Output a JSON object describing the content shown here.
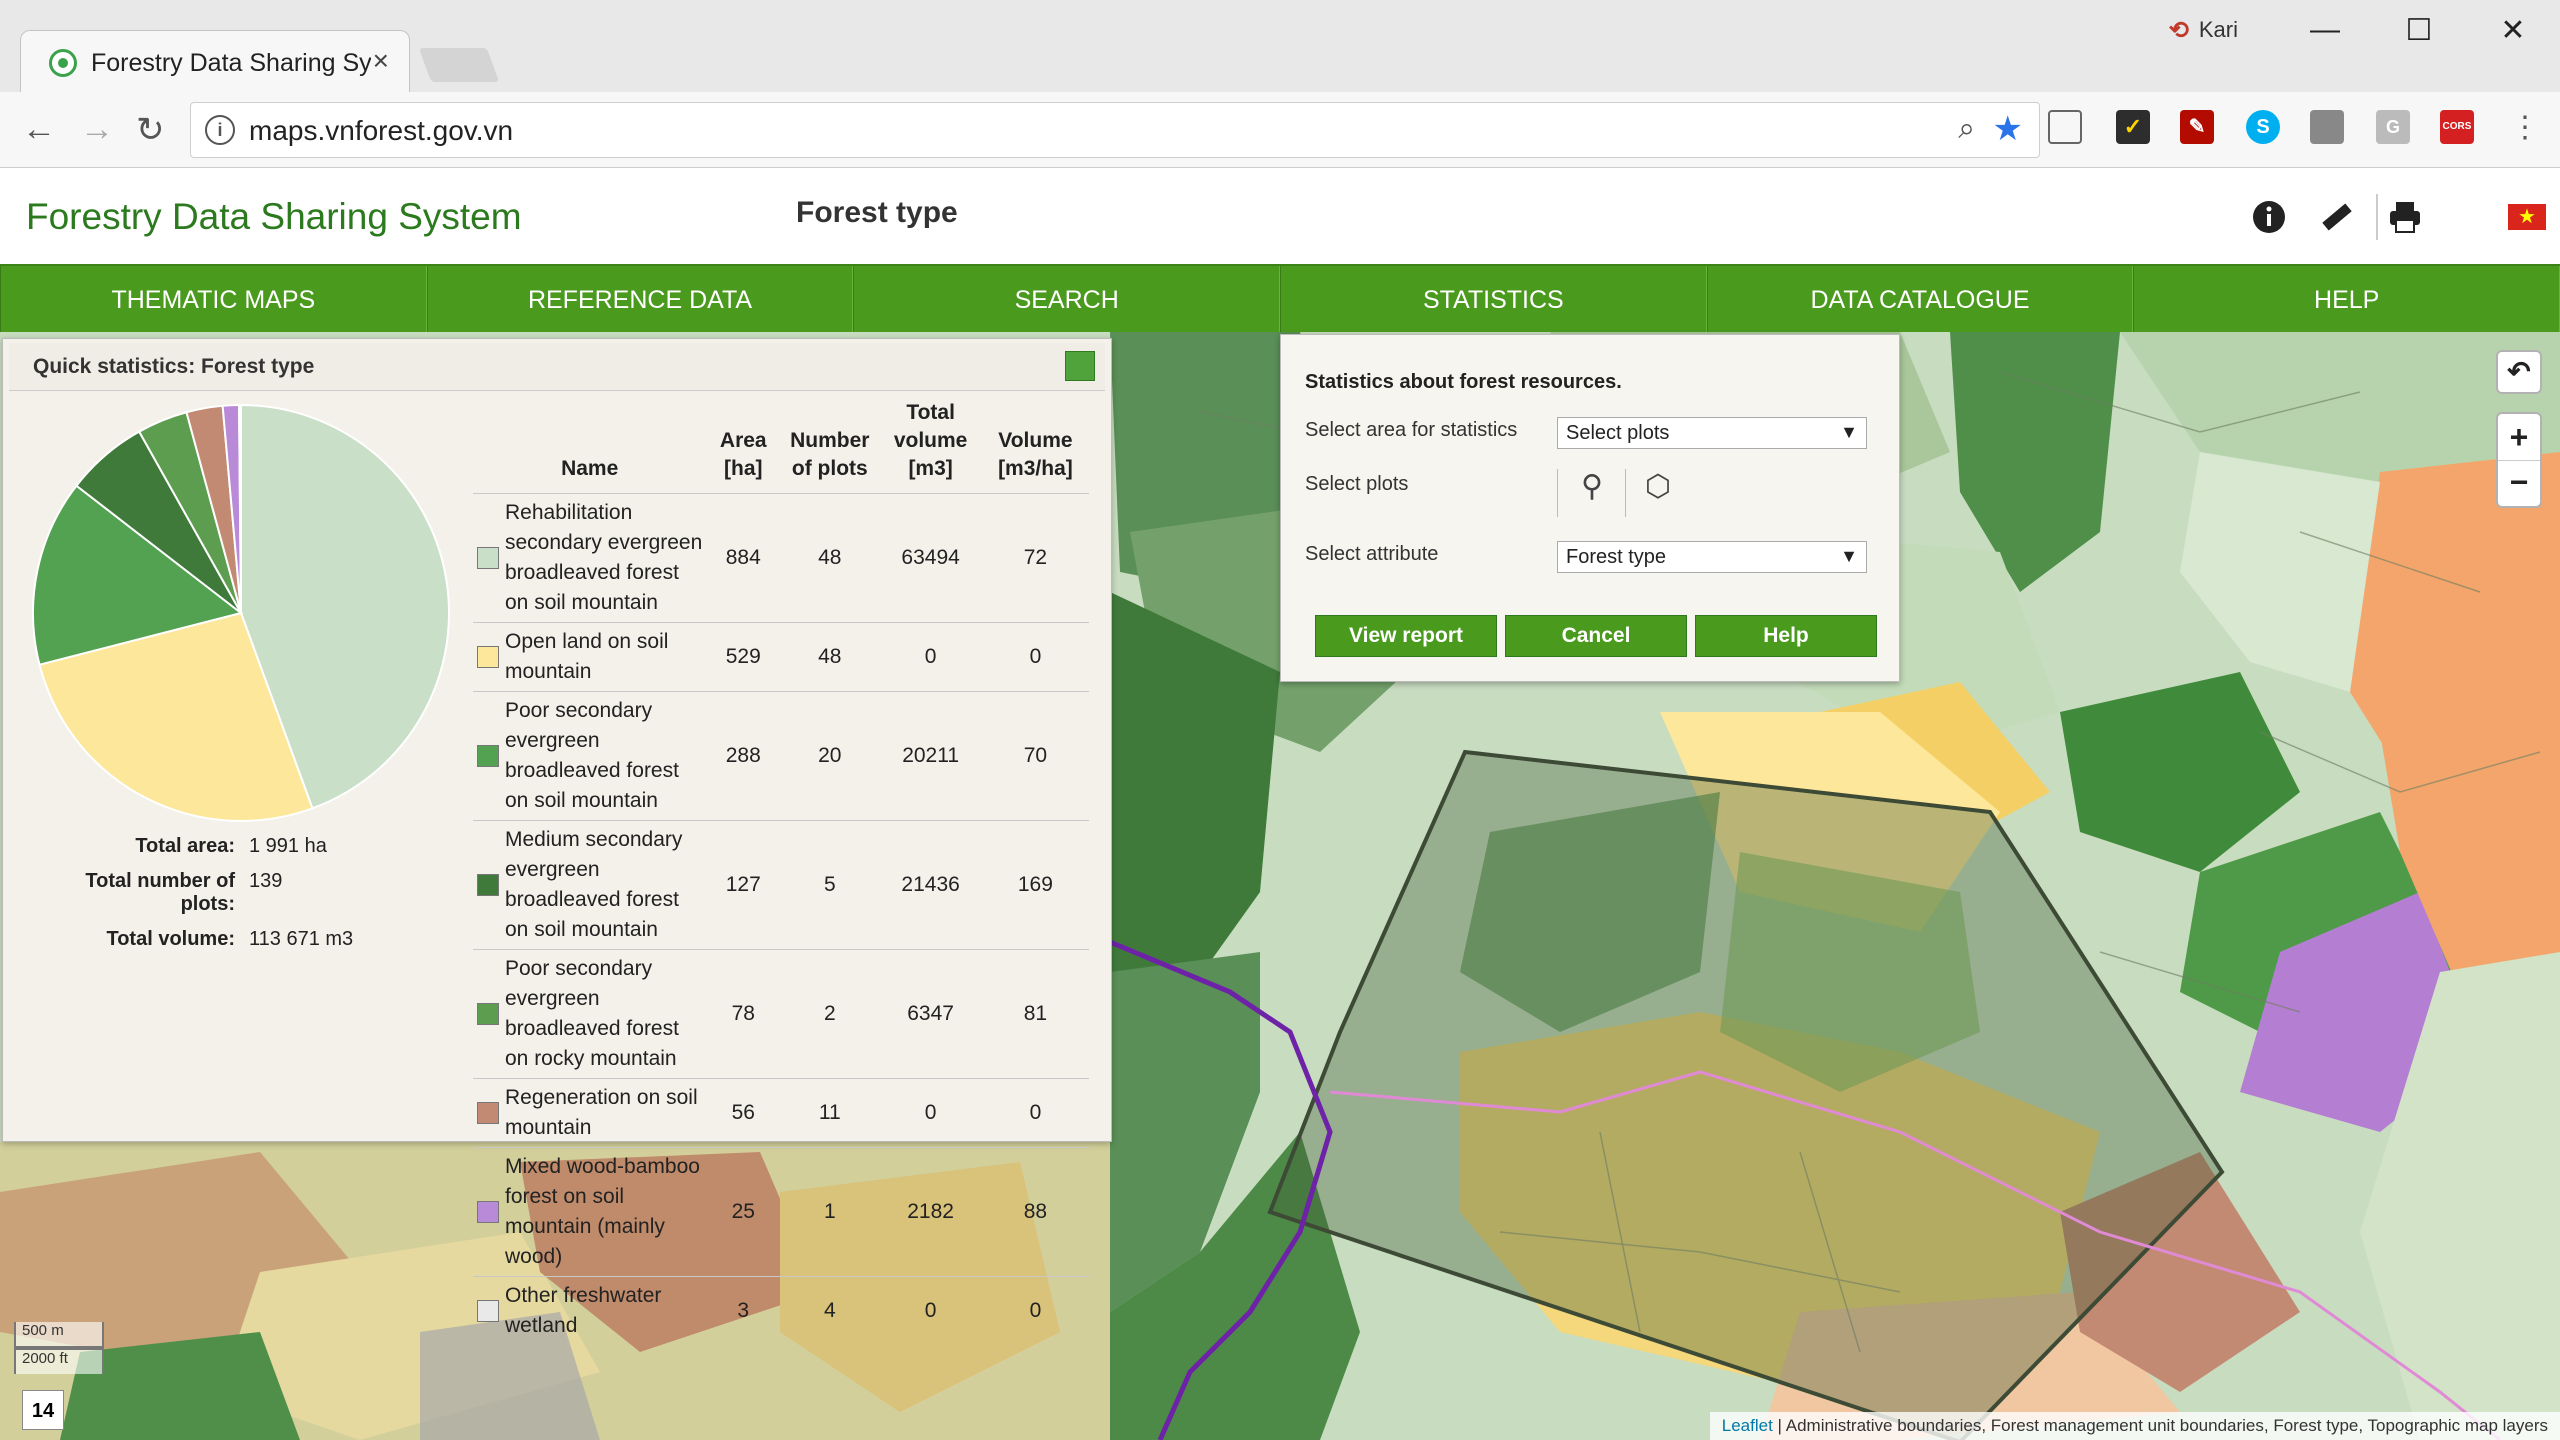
{
  "browser": {
    "tab_title": "Forestry Data Sharing Sys",
    "tab_close": "×",
    "url": "maps.vnforest.gov.vn",
    "user_name": "Kari",
    "window_controls": [
      "—",
      "☐",
      "✕"
    ],
    "extensions": [
      "cast-icon",
      "check-icon",
      "pdf-icon",
      "skype-icon",
      "ext-icon",
      "g-icon",
      "cors-icon",
      "menu-icon"
    ],
    "cors_label": "CORS",
    "g_label": "G"
  },
  "app": {
    "title": "Forestry Data Sharing System",
    "page_title": "Forest type",
    "flag_star": "★"
  },
  "menu": [
    "THEMATIC MAPS",
    "REFERENCE DATA",
    "SEARCH",
    "STATISTICS",
    "DATA CATALOGUE",
    "HELP"
  ],
  "quick_stats": {
    "title": "Quick statistics: Forest type",
    "totals": [
      {
        "label": "Total area:",
        "value": "1 991 ha"
      },
      {
        "label": "Total number of plots:",
        "value": "139"
      },
      {
        "label": "Total volume:",
        "value": "113 671 m3"
      }
    ],
    "columns": [
      "Name",
      "Area [ha]",
      "Number of plots",
      "Total volume [m3]",
      "Volume [m3/ha]"
    ],
    "rows": [
      {
        "name": "Rehabilitation secondary evergreen broadleaved forest on soil mountain",
        "area": "884",
        "plots": "48",
        "total_volume": "63494",
        "volume_ha": "72",
        "color": "#c9dfc7"
      },
      {
        "name": "Open land on soil mountain",
        "area": "529",
        "plots": "48",
        "total_volume": "0",
        "volume_ha": "0",
        "color": "#fde79a"
      },
      {
        "name": "Poor secondary evergreen broadleaved forest on soil mountain",
        "area": "288",
        "plots": "20",
        "total_volume": "20211",
        "volume_ha": "70",
        "color": "#53a251"
      },
      {
        "name": "Medium secondary evergreen broadleaved forest on soil mountain",
        "area": "127",
        "plots": "5",
        "total_volume": "21436",
        "volume_ha": "169",
        "color": "#3f7a3b"
      },
      {
        "name": "Poor secondary evergreen broadleaved forest on rocky mountain",
        "area": "78",
        "plots": "2",
        "total_volume": "6347",
        "volume_ha": "81",
        "color": "#5d9d4f"
      },
      {
        "name": "Regeneration on soil mountain",
        "area": "56",
        "plots": "11",
        "total_volume": "0",
        "volume_ha": "0",
        "color": "#c38a73"
      },
      {
        "name": "Mixed wood-bamboo forest on soil mountain (mainly wood)",
        "area": "25",
        "plots": "1",
        "total_volume": "2182",
        "volume_ha": "88",
        "color": "#b88ad8"
      },
      {
        "name": "Other freshwater wetland",
        "area": "3",
        "plots": "4",
        "total_volume": "0",
        "volume_ha": "0",
        "color": "#e9e9e9"
      }
    ]
  },
  "chart_data": {
    "type": "pie",
    "categories": [
      "Rehabilitation secondary evergreen broadleaved forest on soil mountain",
      "Open land on soil mountain",
      "Poor secondary evergreen broadleaved forest on soil mountain",
      "Medium secondary evergreen broadleaved forest on soil mountain",
      "Poor secondary evergreen broadleaved forest on rocky mountain",
      "Regeneration on soil mountain",
      "Mixed wood-bamboo forest on soil mountain (mainly wood)",
      "Other freshwater wetland"
    ],
    "values": [
      884,
      529,
      288,
      127,
      78,
      56,
      25,
      3
    ],
    "colors": [
      "#c9dfc7",
      "#fde79a",
      "#53a251",
      "#3f7a3b",
      "#5d9d4f",
      "#c38a73",
      "#b88ad8",
      "#e9e9e9"
    ]
  },
  "stat_dialog": {
    "heading": "Statistics about forest resources.",
    "area_label": "Select area for statistics",
    "area_value": "Select plots",
    "plots_label": "Select plots",
    "attribute_label": "Select attribute",
    "attribute_value": "Forest type",
    "view_report": "View report",
    "cancel": "Cancel",
    "help": "Help",
    "arrow": "▼"
  },
  "map": {
    "zoom_in": "+",
    "zoom_out": "−",
    "back": "↶",
    "scale_metric": "500 m",
    "scale_imperial": "2000 ft",
    "zoom_level": "14",
    "attribution_link": "Leaflet",
    "attribution_text": " | Administrative boundaries, Forest management unit boundaries, Forest type, Topographic map layers"
  }
}
